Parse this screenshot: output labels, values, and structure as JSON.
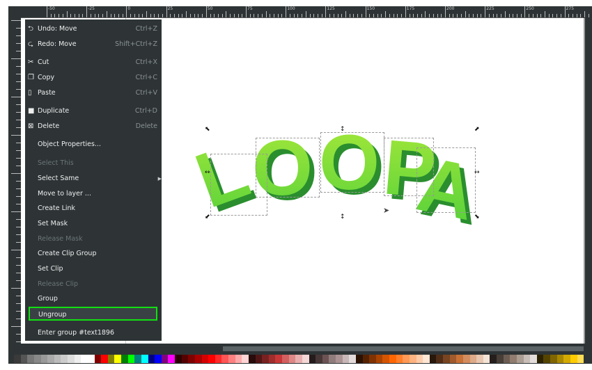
{
  "ruler": {
    "labels": [
      "-50",
      "-25",
      "0",
      "25",
      "50",
      "75",
      "100",
      "125",
      "150",
      "175",
      "200",
      "225",
      "250",
      "275"
    ]
  },
  "menu": {
    "items": [
      {
        "label": "Undo: Move",
        "shortcut": "Ctrl+Z",
        "icon": "undo-icon",
        "glyph": "⮌",
        "enabled": true
      },
      {
        "label": "Redo: Move",
        "shortcut": "Shift+Ctrl+Z",
        "icon": "redo-icon",
        "glyph": "⮎",
        "enabled": true
      },
      {
        "label": "Cut",
        "shortcut": "Ctrl+X",
        "icon": "scissors-icon",
        "glyph": "✂",
        "enabled": true
      },
      {
        "label": "Copy",
        "shortcut": "Ctrl+C",
        "icon": "copy-icon",
        "glyph": "❐",
        "enabled": true
      },
      {
        "label": "Paste",
        "shortcut": "Ctrl+V",
        "icon": "paste-icon",
        "glyph": "▯",
        "enabled": true
      },
      {
        "label": "Duplicate",
        "shortcut": "Ctrl+D",
        "icon": "duplicate-icon",
        "glyph": "■",
        "enabled": true
      },
      {
        "label": "Delete",
        "shortcut": "Delete",
        "icon": "trash-icon",
        "glyph": "⊠",
        "enabled": true
      },
      {
        "label": "Object Properties...",
        "enabled": true
      },
      {
        "label": "Select This",
        "enabled": false
      },
      {
        "label": "Select Same",
        "enabled": true,
        "submenu": true
      },
      {
        "label": "Move to layer ...",
        "enabled": true
      },
      {
        "label": "Create Link",
        "enabled": true
      },
      {
        "label": "Set Mask",
        "enabled": true
      },
      {
        "label": "Release Mask",
        "enabled": false
      },
      {
        "label": "Create Clip Group",
        "enabled": true
      },
      {
        "label": "Set Clip",
        "enabled": true
      },
      {
        "label": "Release Clip",
        "enabled": false
      },
      {
        "label": "Group",
        "enabled": true
      },
      {
        "label": "Ungroup",
        "enabled": true,
        "highlighted": true
      },
      {
        "label": "Enter group #text1896",
        "enabled": true
      }
    ]
  },
  "artwork": {
    "text": "LOOPA",
    "letters": [
      "L",
      "O",
      "O",
      "P",
      "A"
    ],
    "fill_top": "#a6e83a",
    "fill_bottom": "#4fcf3a",
    "shadow": "#2a8e2e"
  },
  "highlight_color": "#11e011",
  "palette": [
    "#3a3a3a",
    "#555",
    "#777",
    "#888",
    "#999",
    "#aaa",
    "#bbb",
    "#ccc",
    "#ddd",
    "#eee",
    "#fff",
    "#fff",
    "#800000",
    "#ff0000",
    "#808000",
    "#ffff00",
    "#008000",
    "#00ff00",
    "#008080",
    "#00ffff",
    "#000080",
    "#0000ff",
    "#800080",
    "#ff00ff",
    "#2b0000",
    "#550000",
    "#800000",
    "#aa0000",
    "#d40000",
    "#ff0000",
    "#ff2a2a",
    "#ff5555",
    "#ff8080",
    "#ffaaaa",
    "#ffd5d5",
    "#280b0b",
    "#501616",
    "#782121",
    "#a02c2c",
    "#c83737",
    "#d35f5f",
    "#de8787",
    "#e9afaf",
    "#f4d7d7",
    "#241c1c",
    "#483737",
    "#6c5353",
    "#917c7c",
    "#ac9393",
    "#c8b7b7",
    "#e3dbdb",
    "#2b1100",
    "#552200",
    "#803300",
    "#aa4400",
    "#d45500",
    "#ff6600",
    "#ff7f2a",
    "#ff9955",
    "#ffb380",
    "#ffccaa",
    "#ffe6d5",
    "#28170b",
    "#502d16",
    "#784421",
    "#a05a2c",
    "#c87137",
    "#d38d5f",
    "#deaa87",
    "#e9c6af",
    "#f4e3d7",
    "#241f1c",
    "#483e37",
    "#6c5d53",
    "#917c6f",
    "#ac9d93",
    "#c8beb7",
    "#e3dedb",
    "#2b2200",
    "#554400",
    "#806600",
    "#aa8800",
    "#d4aa00",
    "#ffcc00",
    "#ffdd55"
  ]
}
